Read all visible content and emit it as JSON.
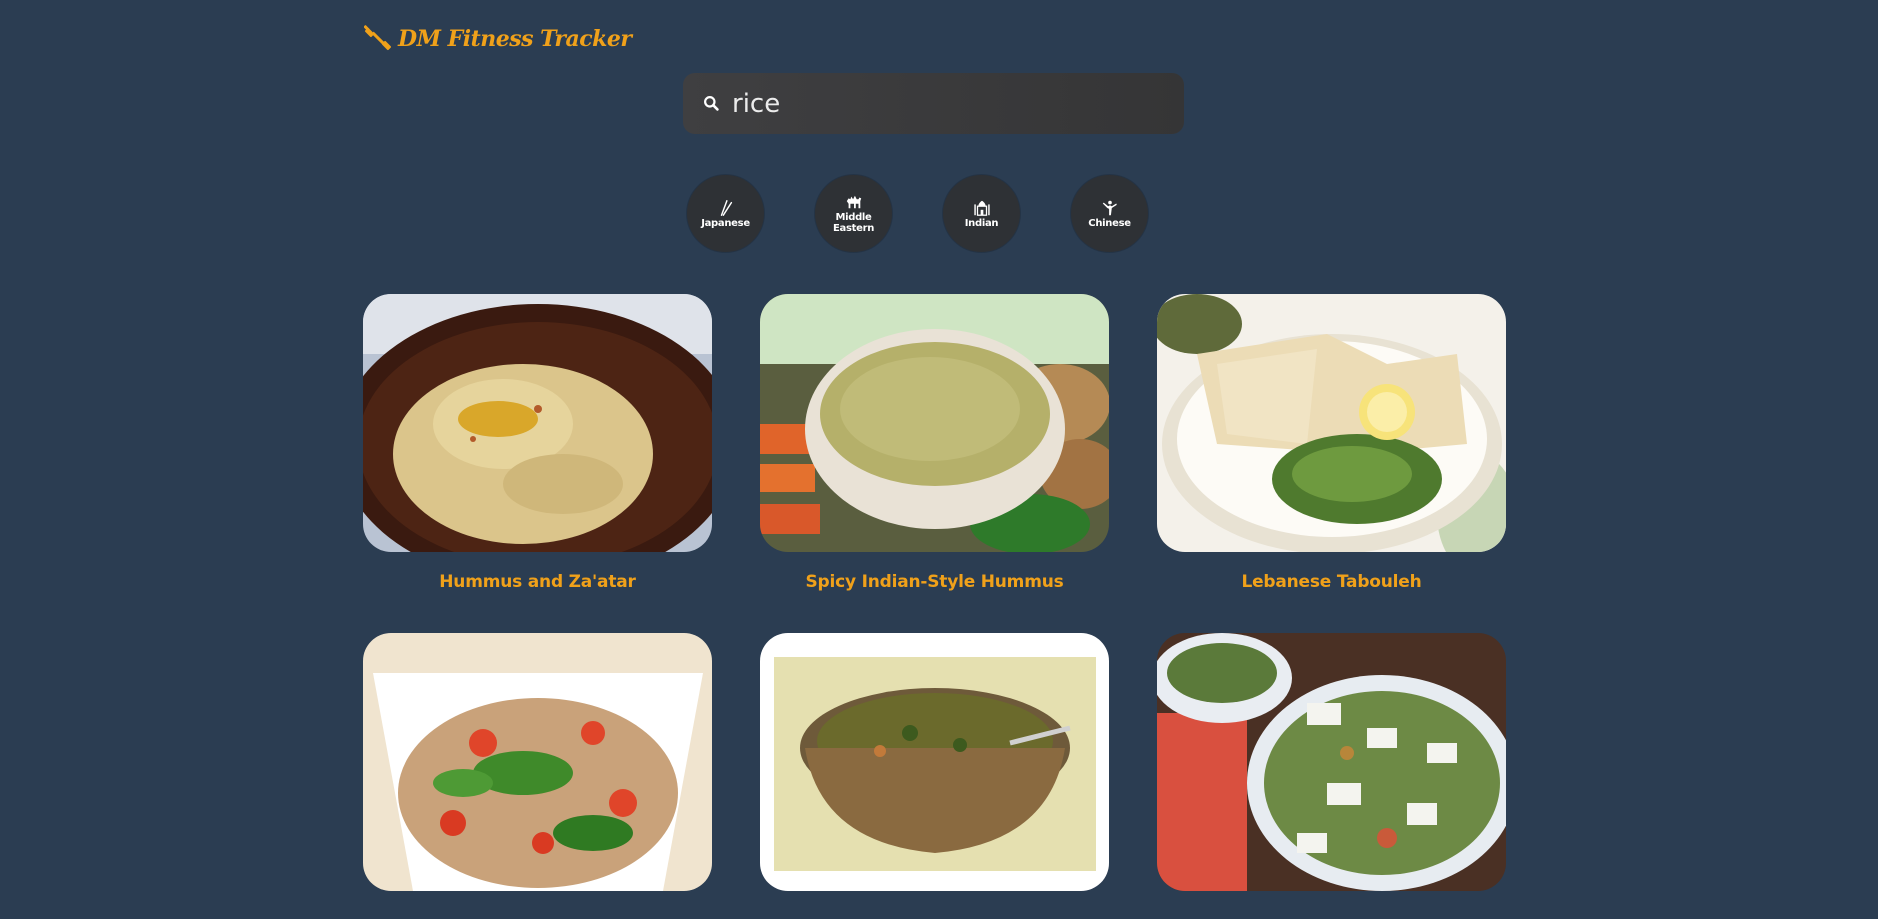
{
  "app": {
    "title": "DM Fitness Tracker",
    "accent": "#f0a11a",
    "background": "#2b3d52"
  },
  "search": {
    "value": "rice",
    "placeholder": ""
  },
  "cuisines": [
    {
      "label": "Japanese",
      "icon": "chopsticks-icon"
    },
    {
      "label": "Middle Eastern",
      "icon": "camel-icon"
    },
    {
      "label": "Indian",
      "icon": "taj-mahal-icon"
    },
    {
      "label": "Chinese",
      "icon": "kung-fu-icon"
    }
  ],
  "recipes": [
    {
      "title": "Hummus and Za'atar",
      "image": "hummus-bowl"
    },
    {
      "title": "Spicy Indian-Style Hummus",
      "image": "green-hummus-with-vegetables"
    },
    {
      "title": "Lebanese Tabouleh",
      "image": "tabouleh-with-pita"
    },
    {
      "title": "",
      "image": "tabbouleh-salad"
    },
    {
      "title": "",
      "image": "lentil-soup"
    },
    {
      "title": "",
      "image": "fattoush-salad"
    }
  ]
}
